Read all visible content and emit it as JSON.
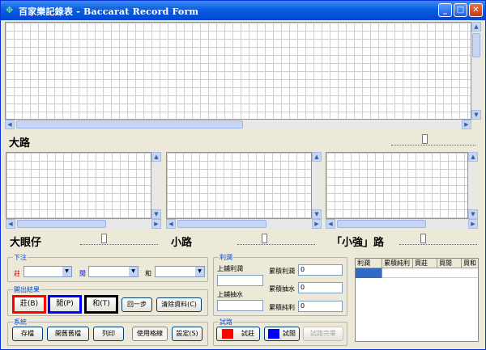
{
  "window": {
    "title": "百家樂記錄表 - Baccarat Record Form"
  },
  "roads": {
    "big": "大路",
    "big_eye": "大眼仔",
    "small": "小路",
    "cockroach": "「小強」路"
  },
  "bet": {
    "caption": "下注",
    "banker": "莊",
    "player": "閒",
    "tie": "和"
  },
  "result": {
    "caption": "開出結果",
    "banker_btn": "莊(B)",
    "player_btn": "閒(P)",
    "tie_btn": "和(T)",
    "undo_btn": "回一步",
    "clear_btn": "清除資料(C)"
  },
  "system": {
    "caption": "系統",
    "save": "存檔",
    "open": "開舊舊檔",
    "print": "列印",
    "grid": "使用格線",
    "settings": "設定(S)"
  },
  "profit": {
    "caption": "利潤",
    "last_profit": "上鋪利潤",
    "last_commission": "上鋪抽水",
    "cum_profit": "累積利潤",
    "cum_profit_val": "0",
    "cum_commission": "累積抽水",
    "cum_commission_val": "0",
    "cum_net": "累積純利",
    "cum_net_val": "0"
  },
  "trial": {
    "caption": "試路",
    "banker": "試莊",
    "player": "試閒",
    "finish": "試路完畢"
  },
  "table": {
    "headers": [
      "利潤",
      "累積純利",
      "買莊",
      "買閒",
      "買和"
    ]
  },
  "colors": {
    "banker": "#ff0000",
    "player": "#0000ff",
    "tie": "#000000",
    "title": "#0a5fe0"
  }
}
